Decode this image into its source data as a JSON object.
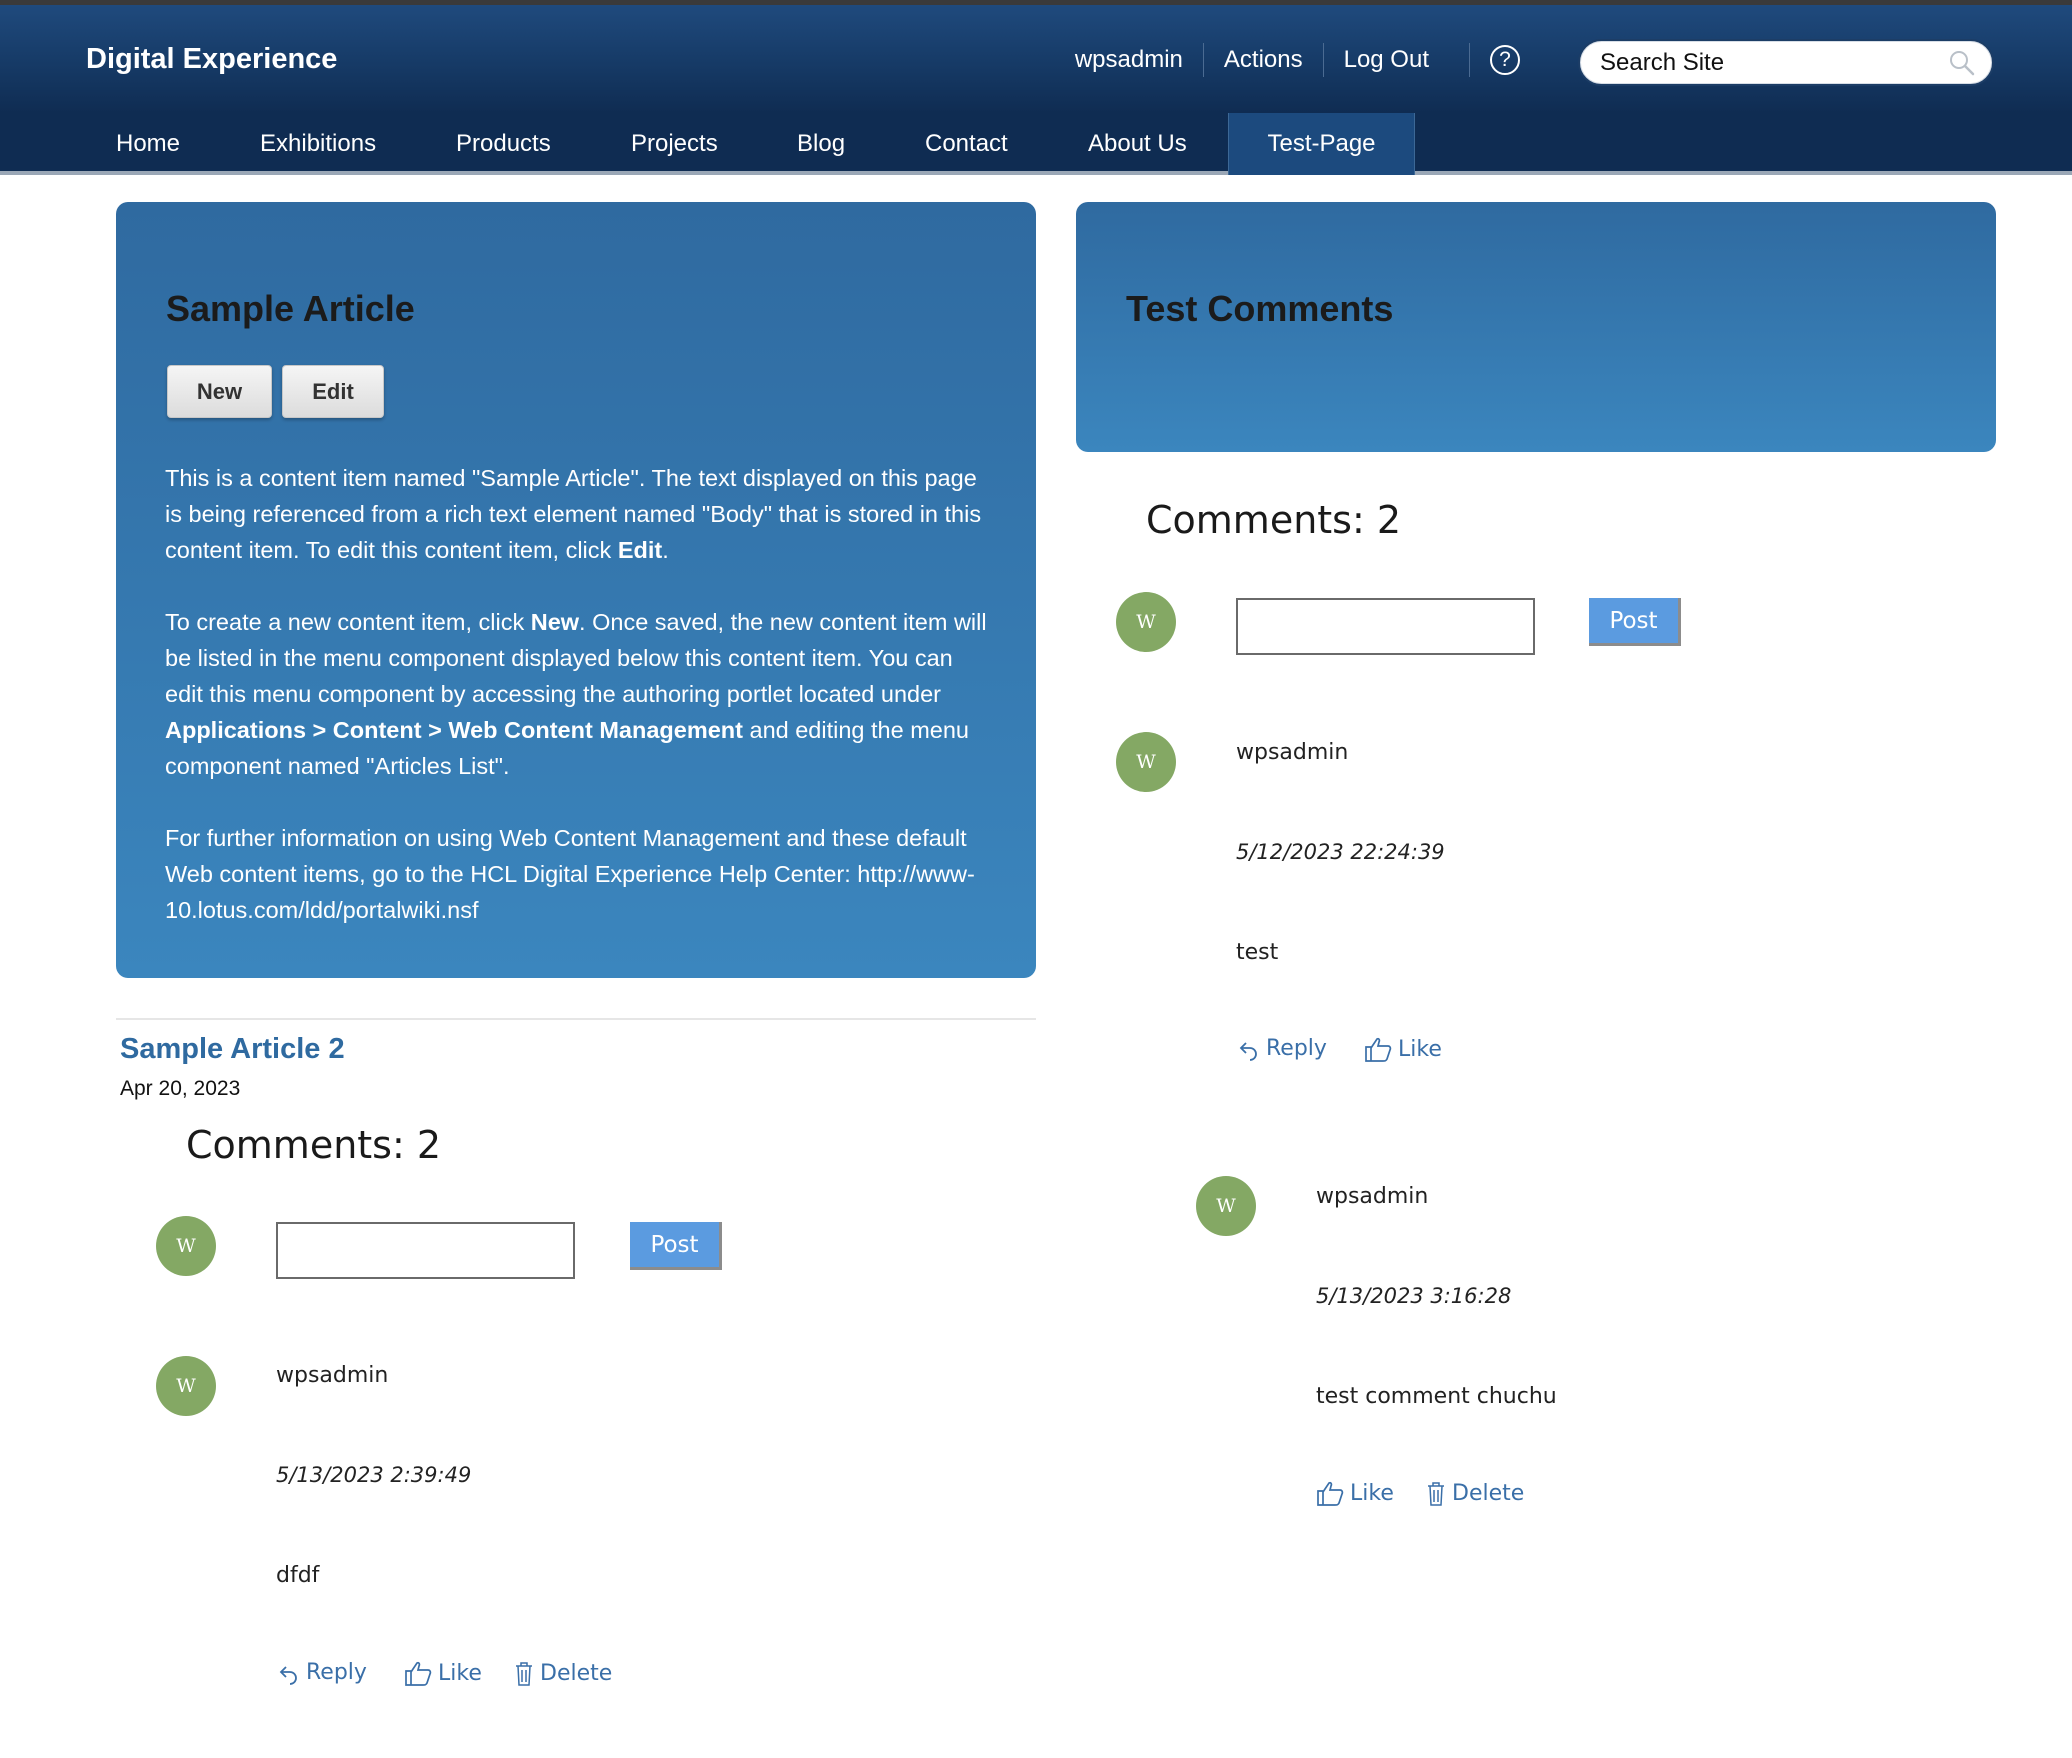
{
  "header": {
    "site_title": "Digital Experience",
    "user": "wpsadmin",
    "actions": "Actions",
    "logout": "Log Out",
    "help_glyph": "?",
    "search_placeholder": "Search Site"
  },
  "nav": {
    "items": [
      "Home",
      "Exhibitions",
      "Products",
      "Projects",
      "Blog",
      "Contact",
      "About Us",
      "Test-Page"
    ],
    "active": "Test-Page"
  },
  "article1": {
    "title": "Sample Article",
    "new_label": "New",
    "edit_label": "Edit",
    "p1_text": "This is a content item named \"Sample Article\". The text displayed on this page is being referenced from a rich text element named \"Body\" that is stored in this content item. To edit this content item, click ",
    "p1_bold": "Edit",
    "p1_end": ".",
    "p2_a": "To create a new content item, click ",
    "p2_bold1": "New",
    "p2_b": ". Once saved, the new content item will be listed in the menu component displayed below this content item. You can edit this menu component by accessing the authoring portlet located under ",
    "p2_bold2": "Applications > Content > Web Content Management",
    "p2_c": " and editing the menu component named \"Articles List\".",
    "p3": "For further information on using Web Content Management and these default Web content items, go to the HCL Digital Experience Help Center: http://www-10.lotus.com/ldd/portalwiki.nsf"
  },
  "article2": {
    "title": "Sample Article 2",
    "date": "Apr 20, 2023",
    "comments_count": "Comments: 2",
    "avatar_initial": "W",
    "post_label": "Post",
    "comments": [
      {
        "user": "wpsadmin",
        "timestamp": "5/13/2023 2:39:49",
        "text": "dfdf",
        "reply": "Reply",
        "like": "Like",
        "delete": "Delete"
      }
    ]
  },
  "test_comments": {
    "title": "Test Comments",
    "comments_count": "Comments: 2",
    "avatar_initial": "W",
    "post_label": "Post",
    "comments": [
      {
        "user": "wpsadmin",
        "timestamp": "5/12/2023 22:24:39",
        "text": "test",
        "reply": "Reply",
        "like": "Like"
      },
      {
        "user": "wpsadmin",
        "timestamp": "5/13/2023 3:16:28",
        "text": "test comment chuchu",
        "like": "Like",
        "delete": "Delete"
      }
    ]
  },
  "colors": {
    "header_bg": "#163a66",
    "nav_bg": "#0f2c52",
    "panel_top": "#2f6aa0",
    "panel_bottom": "#3b86be",
    "link": "#3a6fa8",
    "avatar": "#84a864",
    "post_button": "#5b9be0"
  },
  "icons": [
    "search-icon",
    "help-icon",
    "reply-icon",
    "like-icon",
    "delete-icon"
  ]
}
